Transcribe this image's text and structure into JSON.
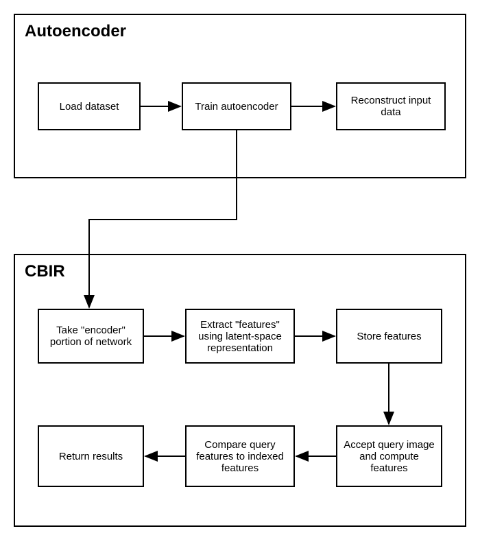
{
  "autoencoder": {
    "title": "Autoencoder",
    "load": "Load dataset",
    "train": "Train autoencoder",
    "reconstruct": "Reconstruct input data"
  },
  "cbir": {
    "title": "CBIR",
    "encoder": "Take \"encoder\" portion of network",
    "extract": "Extract \"features\" using latent-space representation",
    "store": "Store features",
    "accept": "Accept query image and compute features",
    "compare": "Compare query features to indexed features",
    "return": "Return results"
  }
}
